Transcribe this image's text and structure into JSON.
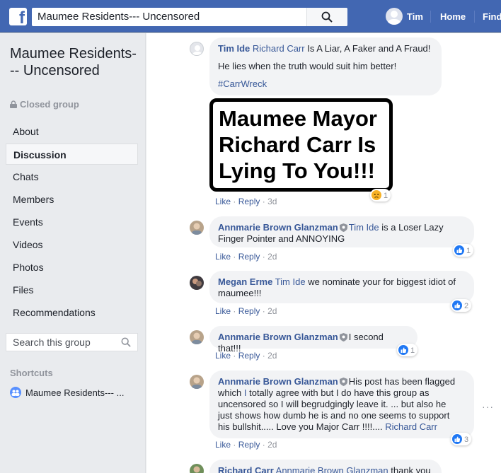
{
  "topbar": {
    "logo": "f",
    "search_value": "Maumee Residents--- Uncensored",
    "profile_name": "Tim",
    "home_label": "Home",
    "find_label": "Find"
  },
  "sidebar": {
    "group_name": "Maumee Residents--- Uncensored",
    "group_type": "Closed group",
    "nav": [
      {
        "label": "About"
      },
      {
        "label": "Discussion",
        "active": true
      },
      {
        "label": "Chats"
      },
      {
        "label": "Members"
      },
      {
        "label": "Events"
      },
      {
        "label": "Videos"
      },
      {
        "label": "Photos"
      },
      {
        "label": "Files"
      },
      {
        "label": "Recommendations"
      }
    ],
    "search_placeholder": "Search this group",
    "shortcuts_heading": "Shortcuts",
    "shortcut_item": "Maumee Residents--- ..."
  },
  "comments": [
    {
      "author": "Tim Ide",
      "mention": "Richard Carr",
      "text1": "Is A Liar, A Faker and A Fraud!",
      "text2": "He lies when the truth would suit him better!",
      "hashtag": "#CarrWreck",
      "meme": [
        "Maumee Mayor",
        "Richard Carr Is",
        "Lying To You!!!"
      ],
      "reaction_count": "1",
      "time": "3d"
    },
    {
      "author": "Annmarie Brown Glanzman",
      "mention": "Tim Ide",
      "text1": "is a Loser Lazy",
      "text2": "Finger Pointer and ANNOYING",
      "reaction_count": "1",
      "time": "2d"
    },
    {
      "author": "Megan Erme",
      "mention": "Tim Ide",
      "text1": "we nominate your for biggest idiot of",
      "text2": "maumee!!!",
      "reaction_count": "2",
      "time": "2d"
    },
    {
      "author": "Annmarie Brown Glanzman",
      "text1": "I second that!!!",
      "reaction_count": "1",
      "time": "2d"
    },
    {
      "author": "Annmarie Brown Glanzman",
      "line1": "His post has been flagged",
      "line2a": "which ",
      "line2b": "I",
      "line2c": " totally agree with but I do have this group as",
      "line3": "uncensored so I will begrudgingly leave it. ... but also he",
      "line4": "just shows how dumb he is and no one seems to support",
      "line5": "his bullshit..... Love you Major Carr !!!!....",
      "mention": "Richard Carr",
      "reaction_count": "3",
      "time": "2d"
    },
    {
      "author": "Richard Carr",
      "mention": "Annmarie Brown Glanzman",
      "text1": "thank you"
    }
  ],
  "actions": {
    "like": "Like",
    "reply": "Reply",
    "sep": "·"
  },
  "more": "···"
}
